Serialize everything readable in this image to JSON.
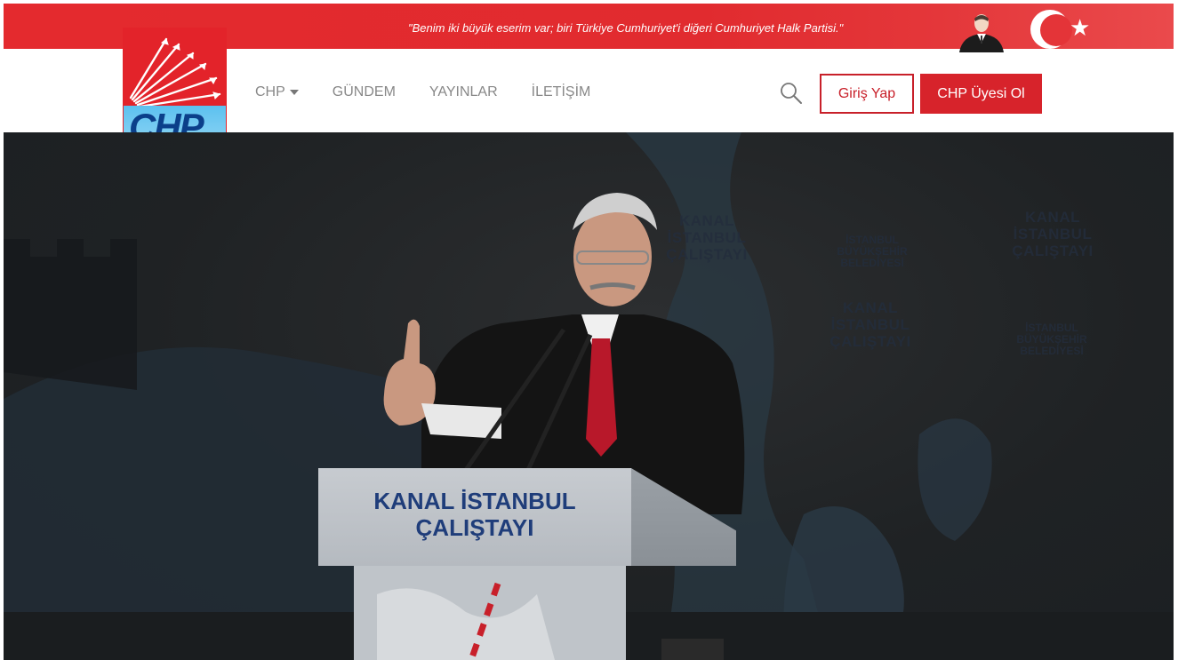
{
  "topbar": {
    "quote": "\"Benim iki büyük eserim var; biri Türkiye Cumhuriyet'i diğeri Cumhuriyet Halk Partisi.\""
  },
  "logo": {
    "text": "CHP"
  },
  "nav": {
    "items": [
      {
        "label": "CHP",
        "has_dropdown": true
      },
      {
        "label": "GÜNDEM",
        "has_dropdown": false
      },
      {
        "label": "YAYINLAR",
        "has_dropdown": false
      },
      {
        "label": "İLETİŞİM",
        "has_dropdown": false
      }
    ],
    "search_icon": "search-icon",
    "login_label": "Giriş Yap",
    "member_label": "CHP Üyesi Ol"
  },
  "hero": {
    "podium_line1": "KANAL İSTANBUL",
    "podium_line2": "ÇALIŞTAYI",
    "backdrop_title_lines": [
      "KANAL",
      "İSTANBUL",
      "ÇALIŞTAYI"
    ],
    "backdrop_logo_lines": [
      "İSTANBUL",
      "BÜYÜKŞEHİR",
      "BELEDİYESİ"
    ]
  },
  "colors": {
    "brand_red": "#e3232a",
    "nav_text": "#888888",
    "logo_blue": "#0b3f8a",
    "logo_sky": "#5cc1ef"
  }
}
